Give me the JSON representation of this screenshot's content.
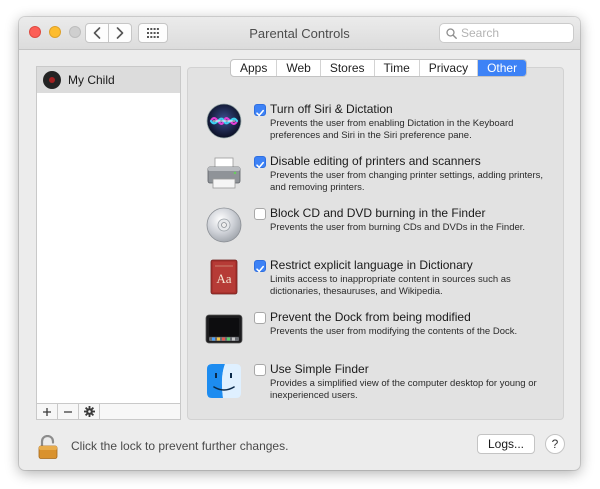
{
  "window": {
    "title": "Parental Controls",
    "search_placeholder": "Search"
  },
  "icons": {
    "back": "chevron-left-icon",
    "forward": "chevron-right-icon",
    "grid": "grid-icon",
    "search": "search-icon",
    "add": "plus-icon",
    "remove": "minus-icon",
    "settings": "gear-icon",
    "lock": "lock-open-icon"
  },
  "users": [
    {
      "name": "My Child",
      "selected": true
    }
  ],
  "list_toolbar": {
    "add_label": "+",
    "remove_label": "–"
  },
  "tabs": [
    {
      "label": "Apps",
      "active": false
    },
    {
      "label": "Web",
      "active": false
    },
    {
      "label": "Stores",
      "active": false
    },
    {
      "label": "Time",
      "active": false
    },
    {
      "label": "Privacy",
      "active": false
    },
    {
      "label": "Other",
      "active": true
    }
  ],
  "options": [
    {
      "icon": "siri-icon",
      "checked": true,
      "title": "Turn off Siri & Dictation",
      "description": "Prevents the user from enabling Dictation in the Keyboard preferences and Siri in the Siri preference pane."
    },
    {
      "icon": "printer-icon",
      "checked": true,
      "title": "Disable editing of printers and scanners",
      "description": "Prevents the user from changing printer settings, adding printers, and removing printers."
    },
    {
      "icon": "cd-icon",
      "checked": false,
      "title": "Block CD and DVD burning in the Finder",
      "description": "Prevents the user from burning CDs and DVDs in the Finder."
    },
    {
      "icon": "dictionary-icon",
      "checked": true,
      "title": "Restrict explicit language in Dictionary",
      "description": "Limits access to inappropriate content in sources such as dictionaries, thesauruses, and Wikipedia."
    },
    {
      "icon": "dock-icon",
      "checked": false,
      "title": "Prevent the Dock from being modified",
      "description": "Prevents the user from modifying the contents of the Dock."
    },
    {
      "icon": "finder-icon",
      "checked": false,
      "title": "Use Simple Finder",
      "description": "Provides a simplified view of the computer desktop for young or inexperienced users."
    }
  ],
  "footer": {
    "lock_text": "Click the lock to prevent further changes.",
    "logs_label": "Logs...",
    "help_label": "?"
  },
  "colors": {
    "accent": "#3d82f6"
  }
}
